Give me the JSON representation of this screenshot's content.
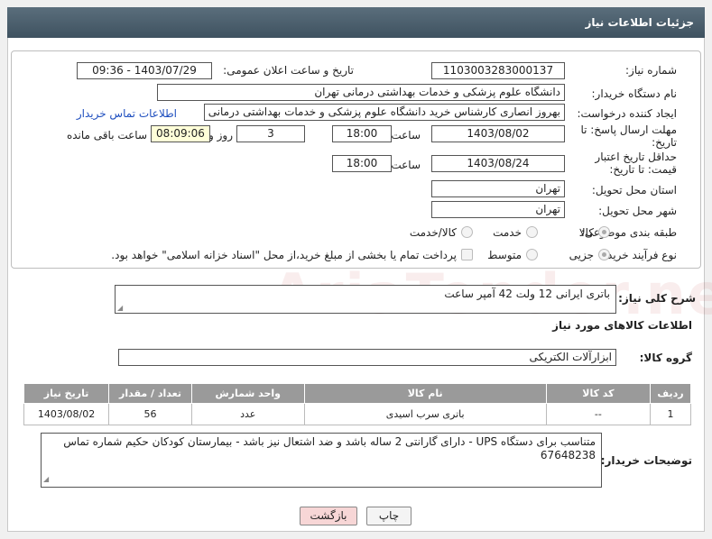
{
  "header": {
    "title": "جزئیات اطلاعات نیاز"
  },
  "form": {
    "need_number_label": "شماره نیاز:",
    "need_number": "1103003283000137",
    "announce_label": "تاریخ و ساعت اعلان عمومی:",
    "announce_value": "1403/07/29 - 09:36",
    "buyer_org_label": "نام دستگاه خریدار:",
    "buyer_org": "دانشگاه علوم پزشکی و خدمات بهداشتی درمانی تهران",
    "creator_label": "ایجاد کننده درخواست:",
    "creator": "بهروز انصاری کارشناس خرید دانشگاه علوم پزشکی و خدمات بهداشتی درمانی",
    "contact_link": "اطلاعات تماس خریدار",
    "reply_deadline_label": "مهلت ارسال پاسخ: تا تاریخ:",
    "reply_date": "1403/08/02",
    "time_label": "ساعت",
    "reply_time": "18:00",
    "days_value": "3",
    "days_label": "روز و",
    "remaining_time": "08:09:06",
    "remaining_label": "ساعت باقی مانده",
    "validity_label": "حداقل تاریخ اعتبار قیمت: تا تاریخ:",
    "validity_date": "1403/08/24",
    "validity_time": "18:00",
    "province_label": "استان محل تحویل:",
    "province": "تهران",
    "city_label": "شهر محل تحویل:",
    "city": "تهران",
    "category_label": "طبقه بندی موضوعی:",
    "category_options": [
      "کالا",
      "خدمت",
      "کالا/خدمت"
    ],
    "purchase_type_label": "نوع فرآیند خرید :",
    "purchase_options": [
      "جزیی",
      "متوسط"
    ],
    "payment_note": "پرداخت تمام یا بخشی از مبلغ خرید،از محل \"اسناد خزانه اسلامی\" خواهد بود."
  },
  "summary": {
    "label": "شرح کلی نیاز:",
    "value": "باتری ایرانی 12 ولت 42 آمپر ساعت"
  },
  "goods_info_title": "اطلاعات کالاهای مورد نیاز",
  "goods_group": {
    "label": "گروه کالا:",
    "value": "ابزارآلات الکتریکی"
  },
  "table": {
    "headers": [
      "ردیف",
      "کد کالا",
      "نام کالا",
      "واحد شمارش",
      "تعداد / مقدار",
      "تاریخ نیاز"
    ],
    "rows": [
      [
        "1",
        "--",
        "باتری سرب اسیدی",
        "عدد",
        "56",
        "1403/08/02"
      ]
    ]
  },
  "buyer_notes": {
    "label": "توضیحات خریدار:",
    "value": "متناسب برای دستگاه UPS - دارای گارانتی 2 ساله باشد و ضد اشتعال نیز باشد - بیمارستان کودکان حکیم شماره تماس 67648238"
  },
  "buttons": {
    "print": "چاپ",
    "back": "بازگشت"
  },
  "watermark": "AriaTender.net",
  "colors": {
    "header": "#4a5e6c",
    "link": "#1f4fbf",
    "back_button": "#f7d6d6"
  }
}
